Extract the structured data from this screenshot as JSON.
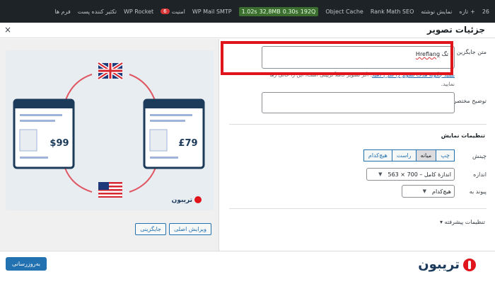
{
  "adminbar": {
    "comments": "26",
    "new_label": "تازه",
    "view_post": "نمایش نوشته",
    "rank_math": "Rank Math SEO",
    "object_cache": "Object Cache",
    "perf_time": "1.02s",
    "perf_mem": "32,8MB",
    "perf_q": "0.30s",
    "perf_count": "192Q",
    "wp_mail": "WP Mail SMTP",
    "notice_count": "6",
    "notice_label": "امنیت",
    "wp_rocket": "WP Rocket",
    "cache_label": "تکثیر کننده پست",
    "forms_label": "فرم ها"
  },
  "modal": {
    "title": "جزئیات تصویر",
    "close": "×"
  },
  "image": {
    "price_left": "$99",
    "price_right": "£79",
    "brand": "تریبون"
  },
  "left_buttons": {
    "edit_original": "ویرایش اصلی",
    "replace": "جایگزینی"
  },
  "fields": {
    "alt_label": "متن جایگزین",
    "alt_value_prefix": "تگ ",
    "alt_value_word": "Hreflang",
    "help_link": "ببینید چگونه هدف تصویر را شرح دهید",
    "help_text": ". اگر تصویر کاملاً تزیینی است، این را خالی رها نمایید.",
    "caption_label": "توضیح مختصر"
  },
  "display": {
    "title": "تنظیمات نمایش",
    "align_label": "چینش",
    "align_options": [
      "چپ",
      "میانه",
      "راست",
      "هیچ‌کدام"
    ],
    "align_selected": "میانه",
    "size_label": "اندازه",
    "size_value": "اندازهٔ کامل – 700 × 563",
    "link_label": "پیوند به",
    "link_value": "هیچ‌کدام",
    "advanced": "تنظیمات پیشرفته ▾"
  },
  "footer": {
    "update_button": "به‌روزرسانی",
    "brand_text": "تریبون"
  },
  "colors": {
    "highlight": "#e0151b",
    "primary": "#2271b1",
    "brand": "#1c3a5a"
  }
}
